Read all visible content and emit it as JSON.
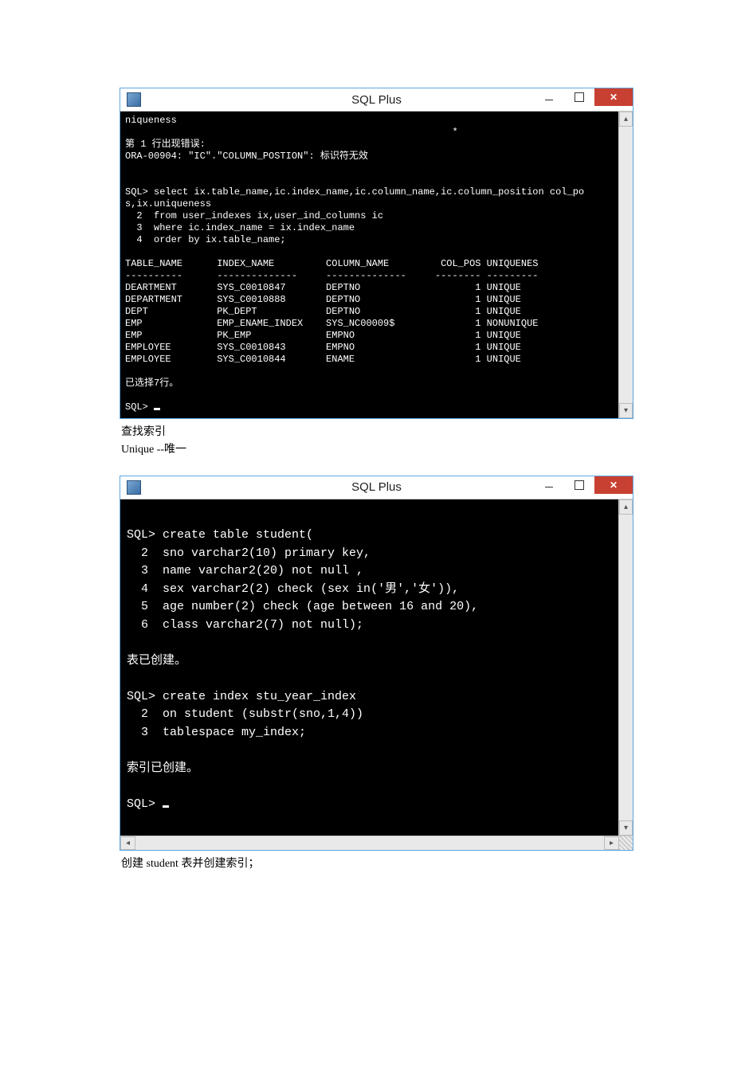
{
  "win1": {
    "title": "SQL Plus",
    "lines": [
      "niqueness",
      "                                                         *",
      "第 1 行出现错误:",
      "ORA-00904: \"IC\".\"COLUMN_POSTION\": 标识符无效",
      "",
      "",
      "SQL> select ix.table_name,ic.index_name,ic.column_name,ic.column_position col_po",
      "s,ix.uniqueness",
      "  2  from user_indexes ix,user_ind_columns ic",
      "  3  where ic.index_name = ix.index_name",
      "  4  order by ix.table_name;",
      "",
      "TABLE_NAME      INDEX_NAME         COLUMN_NAME         COL_POS UNIQUENES",
      "----------      --------------     --------------     -------- ---------",
      "DEARTMENT       SYS_C0010847       DEPTNO                    1 UNIQUE",
      "DEPARTMENT      SYS_C0010888       DEPTNO                    1 UNIQUE",
      "DEPT            PK_DEPT            DEPTNO                    1 UNIQUE",
      "EMP             EMP_ENAME_INDEX    SYS_NC00009$              1 NONUNIQUE",
      "EMP             PK_EMP             EMPNO                     1 UNIQUE",
      "EMPLOYEE        SYS_C0010843       EMPNO                     1 UNIQUE",
      "EMPLOYEE        SYS_C0010844       ENAME                     1 UNIQUE",
      "",
      "已选择7行。",
      "",
      "SQL> _"
    ]
  },
  "caption1_line1": "查找索引",
  "caption1_line2_eng": "Unique",
  "caption1_line2_cn": " --唯一",
  "win2": {
    "title": "SQL Plus",
    "lines": [
      "",
      "SQL> create table student(",
      "  2  sno varchar2(10) primary key,",
      "  3  name varchar2(20) not null ,",
      "  4  sex varchar2(2) check (sex in('男','女')),",
      "  5  age number(2) check (age between 16 and 20),",
      "  6  class varchar2(7) not null);",
      "",
      "表已创建。",
      "",
      "SQL> create index stu_year_index",
      "  2  on student (substr(sno,1,4))",
      "  3  tablespace my_index;",
      "",
      "索引已创建。",
      "",
      "SQL> _"
    ]
  },
  "caption2": "创建 student 表并创建索引；"
}
